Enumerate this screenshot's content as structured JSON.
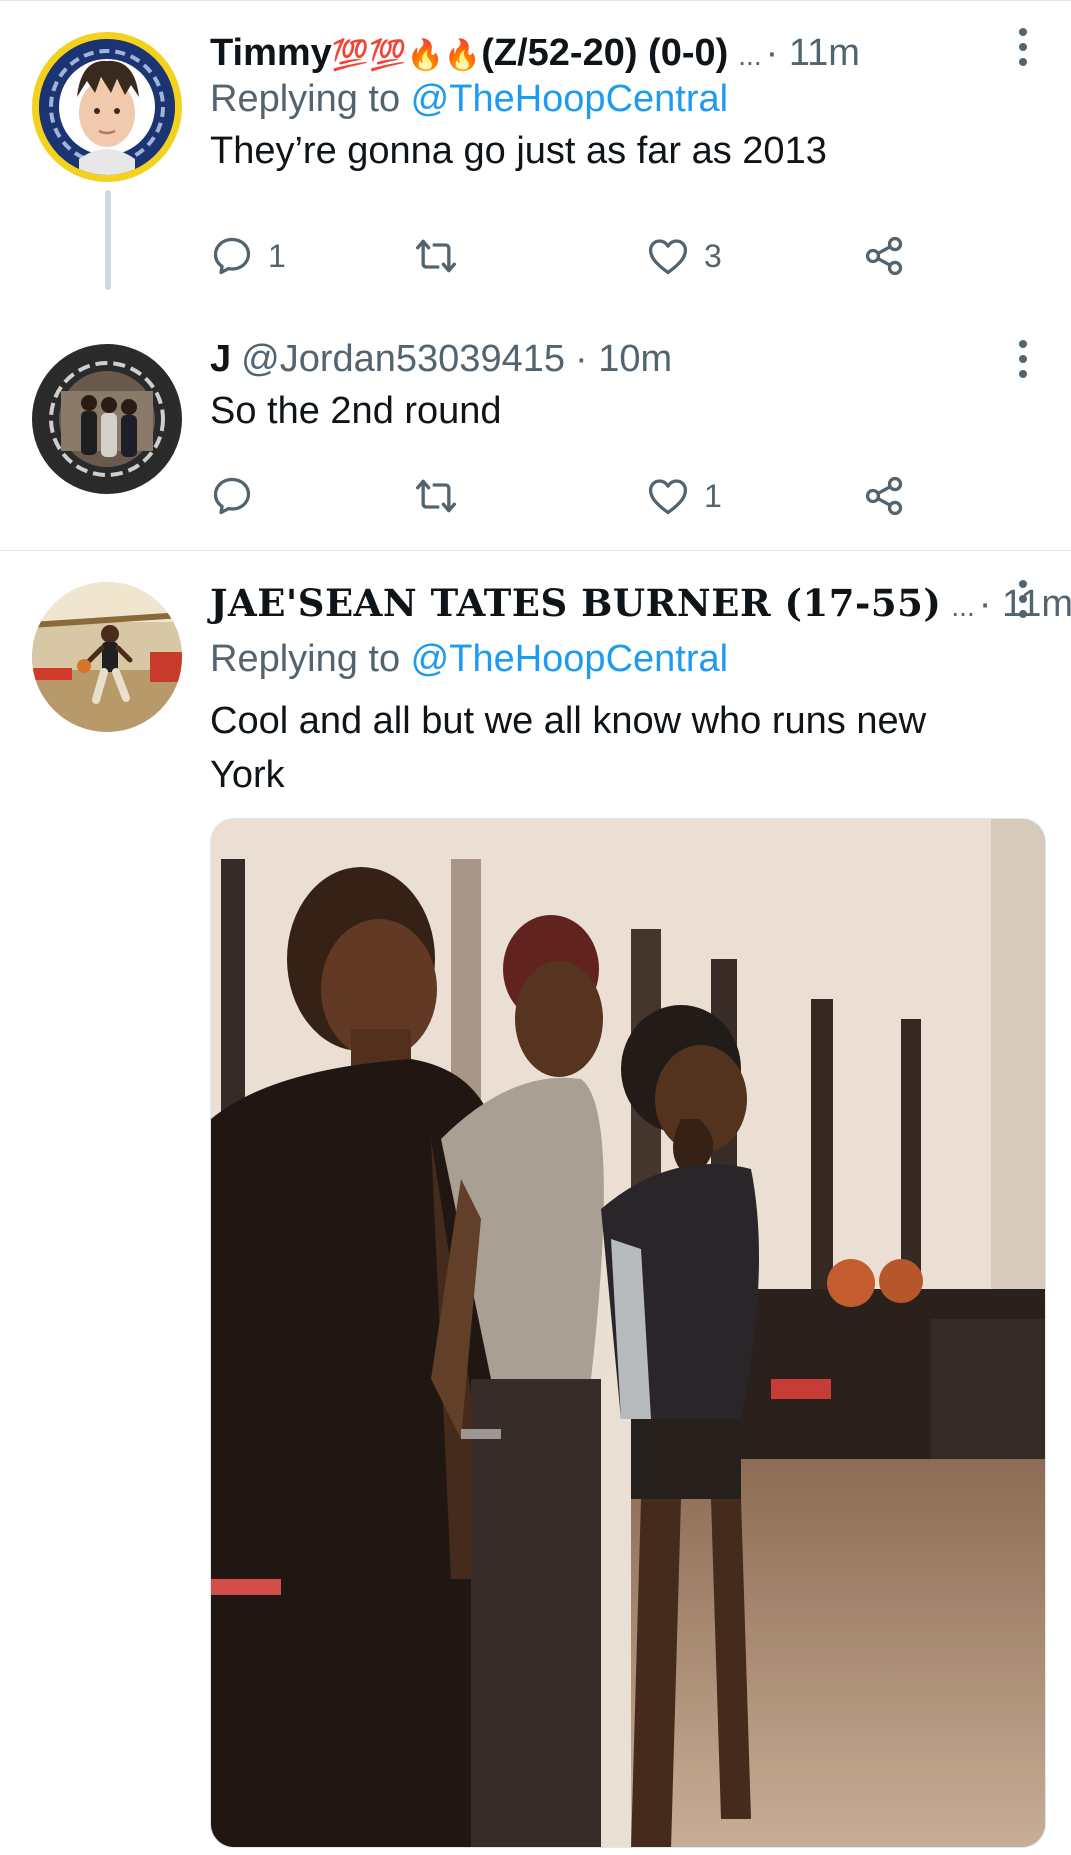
{
  "tweets": [
    {
      "name": "Timmy",
      "name_suffix": " (Z/52-20) (0-0)",
      "ellipsis": "...",
      "time": "· 11m",
      "replying_prefix": "Replying to ",
      "replying_handle": "@TheHoopCentral",
      "text": "They’re gonna go just as far as 2013",
      "replies": "1",
      "retweets": "",
      "likes": "3",
      "emoji": "💯💯🔥🔥"
    },
    {
      "name": "J",
      "handle": "@Jordan53039415",
      "time": "· 10m",
      "text": "So the 2nd round",
      "replies": "",
      "retweets": "",
      "likes": "1"
    },
    {
      "name": "JAE'SEAN TATES BURNER (17-55)",
      "ellipsis": "...",
      "time": "· 11m",
      "replying_prefix": "Replying to ",
      "replying_handle": "@TheHoopCentral",
      "text": "Cool and all but we all know who runs new York"
    }
  ],
  "colors": {
    "link": "#1d9bf0",
    "muted": "#536471",
    "text": "#0f1419",
    "divider": "#e1e8ed"
  },
  "icons": [
    "reply-icon",
    "retweet-icon",
    "like-icon",
    "share-icon",
    "more-icon"
  ]
}
